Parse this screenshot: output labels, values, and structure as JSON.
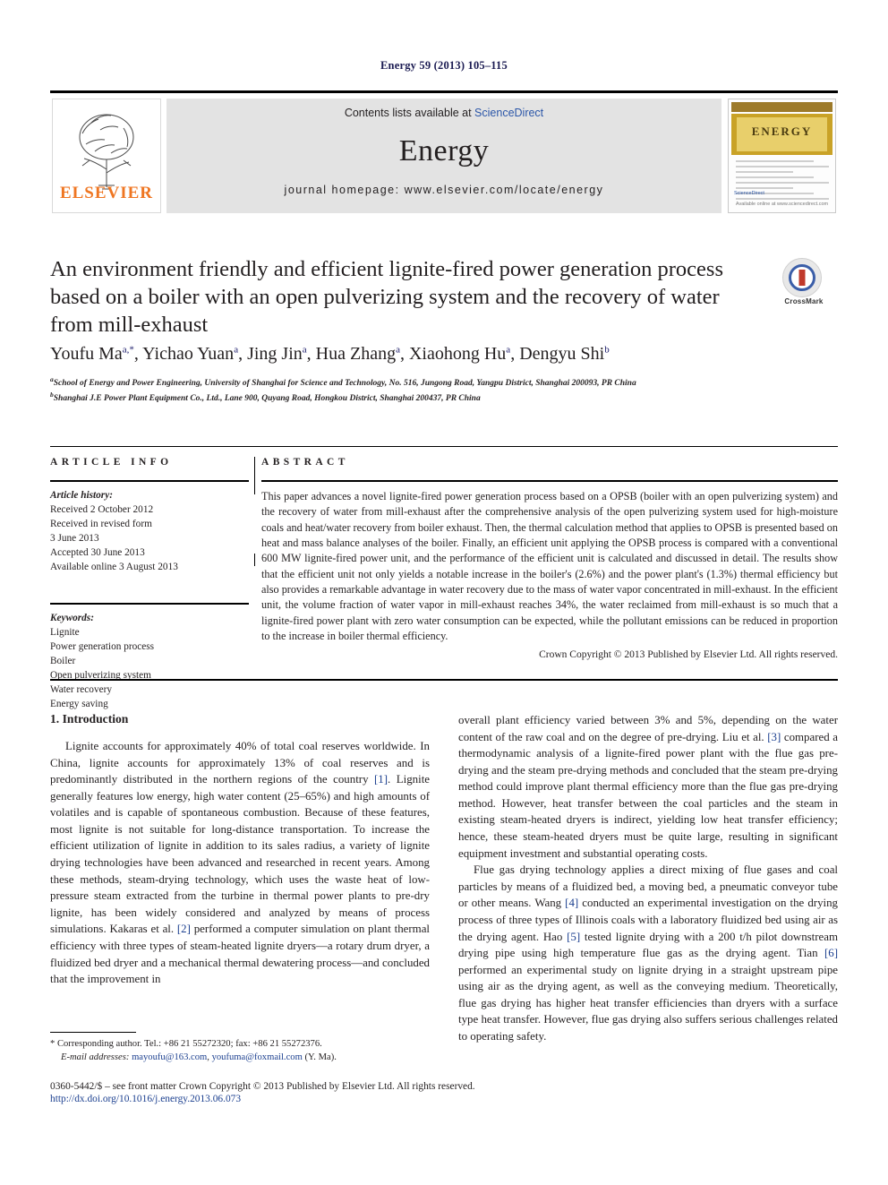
{
  "running_head": "Energy 59 (2013) 105–115",
  "masthead": {
    "contents_prefix": "Contents lists available at ",
    "sciencedirect_link": "ScienceDirect",
    "journal_name": "Energy",
    "homepage": "journal homepage: www.elsevier.com/locate/energy",
    "publisher_wordmark": "ELSEVIER",
    "cover_title": "ENERGY",
    "cover_footer": "Available online at www.sciencedirect.com",
    "cover_sciencedirect": "ScienceDirect"
  },
  "title": "An environment friendly and efficient lignite-fired power generation process based on a boiler with an open pulverizing system and the recovery of water from mill-exhaust",
  "crossmark_label": "CrossMark",
  "authors": [
    {
      "name": "Youfu Ma",
      "marks": "a,*"
    },
    {
      "name": "Yichao Yuan",
      "marks": "a"
    },
    {
      "name": "Jing Jin",
      "marks": "a"
    },
    {
      "name": "Hua Zhang",
      "marks": "a"
    },
    {
      "name": "Xiaohong Hu",
      "marks": "a"
    },
    {
      "name": "Dengyu Shi",
      "marks": "b"
    }
  ],
  "affiliations": [
    {
      "mark": "a",
      "text": "School of Energy and Power Engineering, University of Shanghai for Science and Technology, No. 516, Jungong Road, Yangpu District, Shanghai 200093, PR China"
    },
    {
      "mark": "b",
      "text": "Shanghai J.E Power Plant Equipment Co., Ltd., Lane 900, Quyang Road, Hongkou District, Shanghai 200437, PR China"
    }
  ],
  "article_info": {
    "heading": "ARTICLE INFO",
    "history_label": "Article history:",
    "history": [
      "Received 2 October 2012",
      "Received in revised form",
      "3 June 2013",
      "Accepted 30 June 2013",
      "Available online 3 August 2013"
    ],
    "keywords_label": "Keywords:",
    "keywords": [
      "Lignite",
      "Power generation process",
      "Boiler",
      "Open pulverizing system",
      "Water recovery",
      "Energy saving"
    ]
  },
  "abstract": {
    "heading": "ABSTRACT",
    "text": "This paper advances a novel lignite-fired power generation process based on a OPSB (boiler with an open pulverizing system) and the recovery of water from mill-exhaust after the comprehensive analysis of the open pulverizing system used for high-moisture coals and heat/water recovery from boiler exhaust. Then, the thermal calculation method that applies to OPSB is presented based on heat and mass balance analyses of the boiler. Finally, an efficient unit applying the OPSB process is compared with a conventional 600 MW lignite-fired power unit, and the performance of the efficient unit is calculated and discussed in detail. The results show that the efficient unit not only yields a notable increase in the boiler's (2.6%) and the power plant's (1.3%) thermal efficiency but also provides a remarkable advantage in water recovery due to the mass of water vapor concentrated in mill-exhaust. In the efficient unit, the volume fraction of water vapor in mill-exhaust reaches 34%, the water reclaimed from mill-exhaust is so much that a lignite-fired power plant with zero water consumption can be expected, while the pollutant emissions can be reduced in proportion to the increase in boiler thermal efficiency.",
    "copyright": "Crown Copyright © 2013 Published by Elsevier Ltd. All rights reserved."
  },
  "body": {
    "section_number_title": "1. Introduction",
    "left_paragraphs": [
      "Lignite accounts for approximately 40% of total coal reserves worldwide. In China, lignite accounts for approximately 13% of coal reserves and is predominantly distributed in the northern regions of the country [1]. Lignite generally features low energy, high water content (25–65%) and high amounts of volatiles and is capable of spontaneous combustion. Because of these features, most lignite is not suitable for long-distance transportation. To increase the efficient utilization of lignite in addition to its sales radius, a variety of lignite drying technologies have been advanced and researched in recent years. Among these methods, steam-drying technology, which uses the waste heat of low-pressure steam extracted from the turbine in thermal power plants to pre-dry lignite, has been widely considered and analyzed by means of process simulations. Kakaras et al. [2] performed a computer simulation on plant thermal efficiency with three types of steam-heated lignite dryers—a rotary drum dryer, a fluidized bed dryer and a mechanical thermal dewatering process—and concluded that the improvement in"
    ],
    "right_paragraphs": [
      "overall plant efficiency varied between 3% and 5%, depending on the water content of the raw coal and on the degree of pre-drying. Liu et al. [3] compared a thermodynamic analysis of a lignite-fired power plant with the flue gas pre-drying and the steam pre-drying methods and concluded that the steam pre-drying method could improve plant thermal efficiency more than the flue gas pre-drying method. However, heat transfer between the coal particles and the steam in existing steam-heated dryers is indirect, yielding low heat transfer efficiency; hence, these steam-heated dryers must be quite large, resulting in significant equipment investment and substantial operating costs.",
      "Flue gas drying technology applies a direct mixing of flue gases and coal particles by means of a fluidized bed, a moving bed, a pneumatic conveyor tube or other means. Wang [4] conducted an experimental investigation on the drying process of three types of Illinois coals with a laboratory fluidized bed using air as the drying agent. Hao [5] tested lignite drying with a 200 t/h pilot downstream drying pipe using high temperature flue gas as the drying agent. Tian [6] performed an experimental study on lignite drying in a straight upstream pipe using air as the drying agent, as well as the conveying medium. Theoretically, flue gas drying has higher heat transfer efficiencies than dryers with a surface type heat transfer. However, flue gas drying also suffers serious challenges related to operating safety."
    ]
  },
  "footnote": {
    "corresponding": "* Corresponding author. Tel.: +86 21 55272320; fax: +86 21 55272376.",
    "email_label": "E-mail addresses:",
    "email1": "mayoufu@163.com",
    "email_sep": ", ",
    "email2": "youfuma@foxmail.com",
    "email_suffix": " (Y. Ma)."
  },
  "footer": {
    "line1": "0360-5442/$ – see front matter Crown Copyright © 2013 Published by Elsevier Ltd. All rights reserved.",
    "doi": "http://dx.doi.org/10.1016/j.energy.2013.06.073"
  },
  "colors": {
    "link_blue": "#1b3f8f",
    "sciencedirect_blue": "#2b56a8",
    "elsevier_orange": "#ef7622",
    "masthead_grey": "#e3e3e3",
    "cover_gold": "#c9a227"
  }
}
